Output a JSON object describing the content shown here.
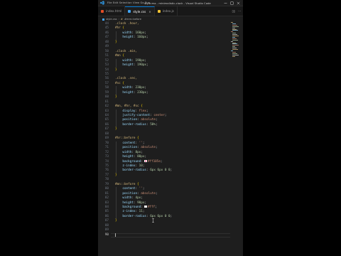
{
  "window": {
    "title": "style.css - minimalistic-clock - Visual Studio Code",
    "menu_label": "File Edit Selection View Go Run …"
  },
  "tabs": [
    {
      "label": "index.html",
      "icon": "html-file-icon",
      "color": "#e44d26",
      "active": false
    },
    {
      "label": "style.css",
      "icon": "css-file-icon",
      "color": "#42a5f5",
      "active": true
    },
    {
      "label": "index.js",
      "icon": "js-file-icon",
      "color": "#f1c232",
      "active": false
    }
  ],
  "breadcrumb": {
    "file": "style.css",
    "selector": "#mm::before"
  },
  "editor": {
    "current_line": "90",
    "lines": [
      {
        "n": "44",
        "t": [
          [
            "sel",
            ".clock .hour,"
          ]
        ]
      },
      {
        "n": "45",
        "t": [
          [
            "sel",
            "#hr "
          ],
          [
            "brace",
            "{"
          ]
        ]
      },
      {
        "n": "46",
        "t": [
          [
            "ind",
            "    "
          ],
          [
            "prop",
            "width"
          ],
          [
            "punc",
            ": "
          ],
          [
            "num",
            "160px"
          ],
          [
            "punc",
            ";"
          ]
        ]
      },
      {
        "n": "47",
        "t": [
          [
            "ind",
            "    "
          ],
          [
            "prop",
            "height"
          ],
          [
            "punc",
            ": "
          ],
          [
            "num",
            "160px"
          ],
          [
            "punc",
            ";"
          ]
        ]
      },
      {
        "n": "48",
        "t": [
          [
            "brace",
            "}"
          ]
        ]
      },
      {
        "n": "49",
        "t": []
      },
      {
        "n": "50",
        "t": [
          [
            "sel",
            ".clock .min,"
          ]
        ]
      },
      {
        "n": "51",
        "t": [
          [
            "sel",
            "#mn "
          ],
          [
            "brace",
            "{"
          ]
        ]
      },
      {
        "n": "52",
        "t": [
          [
            "ind",
            "    "
          ],
          [
            "prop",
            "width"
          ],
          [
            "punc",
            ": "
          ],
          [
            "num",
            "190px"
          ],
          [
            "punc",
            ";"
          ]
        ]
      },
      {
        "n": "53",
        "t": [
          [
            "ind",
            "    "
          ],
          [
            "prop",
            "height"
          ],
          [
            "punc",
            ": "
          ],
          [
            "num",
            "190px"
          ],
          [
            "punc",
            ";"
          ]
        ]
      },
      {
        "n": "54",
        "t": [
          [
            "brace",
            "}"
          ]
        ]
      },
      {
        "n": "55",
        "t": []
      },
      {
        "n": "56",
        "t": [
          [
            "sel",
            ".clock .sec,"
          ]
        ]
      },
      {
        "n": "57",
        "t": [
          [
            "sel",
            "#sc "
          ],
          [
            "brace",
            "{"
          ]
        ]
      },
      {
        "n": "58",
        "t": [
          [
            "ind",
            "    "
          ],
          [
            "prop",
            "width"
          ],
          [
            "punc",
            ": "
          ],
          [
            "num",
            "230px"
          ],
          [
            "punc",
            ";"
          ]
        ]
      },
      {
        "n": "59",
        "t": [
          [
            "ind",
            "    "
          ],
          [
            "prop",
            "height"
          ],
          [
            "punc",
            ": "
          ],
          [
            "num",
            "230px"
          ],
          [
            "punc",
            ";"
          ]
        ]
      },
      {
        "n": "60",
        "t": [
          [
            "brace",
            "}"
          ]
        ]
      },
      {
        "n": "61",
        "t": []
      },
      {
        "n": "62",
        "t": [
          [
            "sel",
            "#mn, #hr, #sc "
          ],
          [
            "brace",
            "{"
          ]
        ]
      },
      {
        "n": "63",
        "t": [
          [
            "ind",
            "    "
          ],
          [
            "prop",
            "display"
          ],
          [
            "punc",
            ": "
          ],
          [
            "val",
            "flex"
          ],
          [
            "punc",
            ";"
          ]
        ]
      },
      {
        "n": "64",
        "t": [
          [
            "ind",
            "    "
          ],
          [
            "prop",
            "justify-content"
          ],
          [
            "punc",
            ": "
          ],
          [
            "val",
            "center"
          ],
          [
            "punc",
            ";"
          ]
        ]
      },
      {
        "n": "65",
        "t": [
          [
            "ind",
            "    "
          ],
          [
            "prop",
            "position"
          ],
          [
            "punc",
            ": "
          ],
          [
            "val",
            "absolute"
          ],
          [
            "punc",
            ";"
          ]
        ]
      },
      {
        "n": "66",
        "t": [
          [
            "ind",
            "    "
          ],
          [
            "prop",
            "border-radius"
          ],
          [
            "punc",
            ": "
          ],
          [
            "num",
            "50%"
          ],
          [
            "punc",
            ";"
          ]
        ]
      },
      {
        "n": "67",
        "t": [
          [
            "brace",
            "}"
          ]
        ]
      },
      {
        "n": "68",
        "t": []
      },
      {
        "n": "69",
        "t": [
          [
            "sel",
            "#hr::before "
          ],
          [
            "brace",
            "{"
          ]
        ]
      },
      {
        "n": "70",
        "t": [
          [
            "ind",
            "    "
          ],
          [
            "prop",
            "content"
          ],
          [
            "punc",
            ": "
          ],
          [
            "val",
            "''"
          ],
          [
            "punc",
            ";"
          ]
        ]
      },
      {
        "n": "71",
        "t": [
          [
            "ind",
            "    "
          ],
          [
            "prop",
            "position"
          ],
          [
            "punc",
            ": "
          ],
          [
            "val",
            "absolute"
          ],
          [
            "punc",
            ";"
          ]
        ]
      },
      {
        "n": "72",
        "t": [
          [
            "ind",
            "    "
          ],
          [
            "prop",
            "width"
          ],
          [
            "punc",
            ": "
          ],
          [
            "num",
            "8px"
          ],
          [
            "punc",
            ";"
          ]
        ]
      },
      {
        "n": "73",
        "t": [
          [
            "ind",
            "    "
          ],
          [
            "prop",
            "height"
          ],
          [
            "punc",
            ": "
          ],
          [
            "num",
            "80px"
          ],
          [
            "punc",
            ";"
          ]
        ]
      },
      {
        "n": "74",
        "t": [
          [
            "ind",
            "    "
          ],
          [
            "prop",
            "background"
          ],
          [
            "punc",
            ": "
          ],
          [
            "swatch",
            "#ff105e"
          ],
          [
            "val",
            "#ff105e"
          ],
          [
            "punc",
            ";"
          ]
        ]
      },
      {
        "n": "75",
        "t": [
          [
            "ind",
            "    "
          ],
          [
            "prop",
            "z-index"
          ],
          [
            "punc",
            ": "
          ],
          [
            "num",
            "10"
          ],
          [
            "punc",
            ";"
          ]
        ]
      },
      {
        "n": "76",
        "t": [
          [
            "ind",
            "    "
          ],
          [
            "prop",
            "border-radius"
          ],
          [
            "punc",
            ": "
          ],
          [
            "num",
            "6px 6px 0 0"
          ],
          [
            "punc",
            ";"
          ]
        ]
      },
      {
        "n": "77",
        "t": [
          [
            "brace",
            "}"
          ]
        ]
      },
      {
        "n": "78",
        "t": []
      },
      {
        "n": "79",
        "t": [
          [
            "sel",
            "#mn::before "
          ],
          [
            "brace",
            "{"
          ]
        ]
      },
      {
        "n": "80",
        "t": [
          [
            "ind",
            "    "
          ],
          [
            "prop",
            "content"
          ],
          [
            "punc",
            ": "
          ],
          [
            "val",
            "''"
          ],
          [
            "punc",
            ";"
          ]
        ]
      },
      {
        "n": "81",
        "t": [
          [
            "ind",
            "    "
          ],
          [
            "prop",
            "position"
          ],
          [
            "punc",
            ": "
          ],
          [
            "val",
            "absolute"
          ],
          [
            "punc",
            ";"
          ]
        ]
      },
      {
        "n": "82",
        "t": [
          [
            "ind",
            "    "
          ],
          [
            "prop",
            "width"
          ],
          [
            "punc",
            ": "
          ],
          [
            "num",
            "4px"
          ],
          [
            "punc",
            ";"
          ]
        ]
      },
      {
        "n": "83",
        "t": [
          [
            "ind",
            "    "
          ],
          [
            "prop",
            "height"
          ],
          [
            "punc",
            ": "
          ],
          [
            "num",
            "90px"
          ],
          [
            "punc",
            ";"
          ]
        ]
      },
      {
        "n": "84",
        "t": [
          [
            "ind",
            "    "
          ],
          [
            "prop",
            "background"
          ],
          [
            "punc",
            ": "
          ],
          [
            "swatch",
            "#fff"
          ],
          [
            "val",
            "#fff"
          ],
          [
            "punc",
            ";"
          ]
        ]
      },
      {
        "n": "85",
        "t": [
          [
            "ind",
            "    "
          ],
          [
            "prop",
            "z-index"
          ],
          [
            "punc",
            ": "
          ],
          [
            "num",
            "11"
          ],
          [
            "punc",
            ";"
          ]
        ]
      },
      {
        "n": "86",
        "t": [
          [
            "ind",
            "    "
          ],
          [
            "prop",
            "border-radius"
          ],
          [
            "punc",
            ": "
          ],
          [
            "num",
            "6px 6px 0 0"
          ],
          [
            "punc",
            ";"
          ]
        ]
      },
      {
        "n": "87",
        "t": [
          [
            "brace",
            "}"
          ]
        ]
      },
      {
        "n": "88",
        "t": []
      },
      {
        "n": "89",
        "t": []
      },
      {
        "n": "90",
        "t": []
      }
    ]
  },
  "colors": {
    "background": "#000000",
    "editor_bg": "#1e1e1e",
    "accent": "#0078d4"
  }
}
